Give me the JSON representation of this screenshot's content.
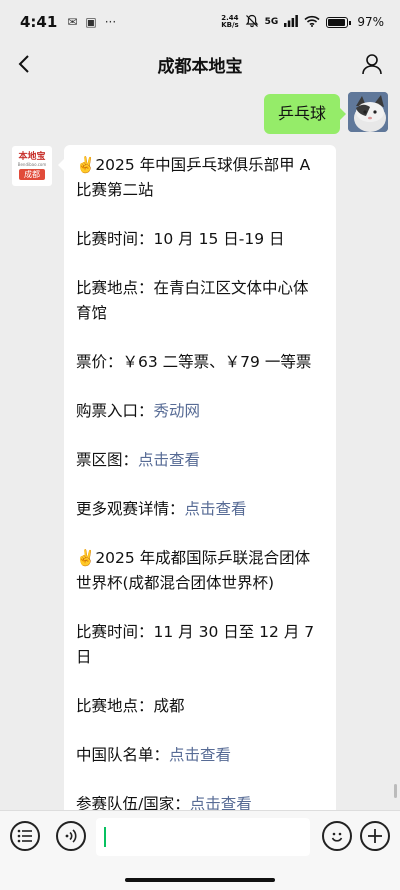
{
  "status": {
    "time": "4:41",
    "speed_top": "2.44",
    "speed_bottom": "KB/s",
    "network": "5G",
    "battery": "97%"
  },
  "nav": {
    "title": "成都本地宝"
  },
  "user_message": {
    "text": "乒乓球"
  },
  "bot_avatar": {
    "logo": "本地宝",
    "sub": "Bendibao.com",
    "city": "成都"
  },
  "bot_message": {
    "lines": [
      {
        "hand": "✌️",
        "text": "2025 年中国乒乓球俱乐部甲 A 比赛第二站"
      },
      {
        "label": "比赛时间：",
        "value": "10 月 15 日-19 日"
      },
      {
        "label": "比赛地点：",
        "value": "在青白江区文体中心体育馆"
      },
      {
        "label": "票价：",
        "value": "￥63 二等票、￥79 一等票"
      },
      {
        "label": "购票入口：",
        "link": "秀动网"
      },
      {
        "label": "票区图：",
        "link": "点击查看"
      },
      {
        "label": "更多观赛详情：",
        "link": "点击查看"
      },
      {
        "hand": "✌️",
        "text": "2025 年成都国际乒联混合团体世界杯(成都混合团体世界杯)"
      },
      {
        "label": "比赛时间：",
        "value": "11 月 30 日至 12 月 7 日"
      },
      {
        "label": "比赛地点：",
        "value": "成都"
      },
      {
        "label": "中国队名单：",
        "link": "点击查看"
      },
      {
        "label": "参赛队伍/国家：",
        "link": "点击查看"
      }
    ]
  },
  "icons": {
    "back": "chevron-left-icon",
    "profile": "person-icon",
    "menu": "list-menu-icon",
    "voice": "voice-icon",
    "emoji": "smiley-icon",
    "add": "plus-icon"
  },
  "colors": {
    "user_bubble": "#95ec69",
    "link": "#576b95",
    "background": "#ededed"
  }
}
